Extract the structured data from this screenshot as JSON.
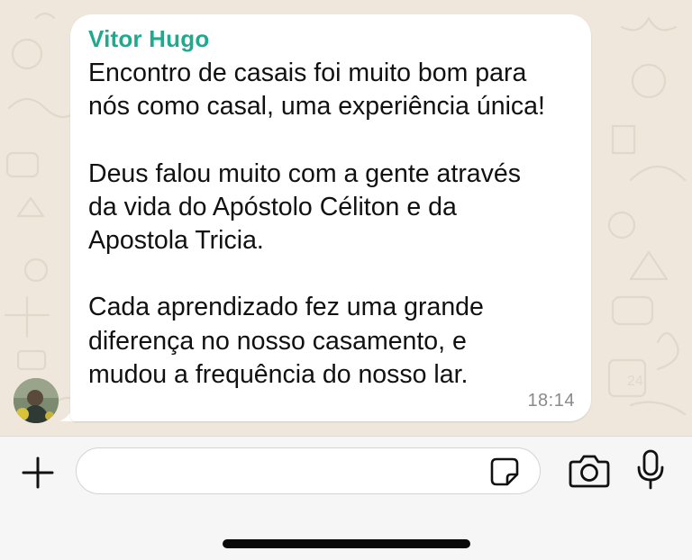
{
  "chat": {
    "wallpaper_color": "#efe7dc",
    "message": {
      "sender": "Vitor Hugo",
      "sender_color": "#1faa8f",
      "text": "Encontro de casais foi muito bom para\nnós como casal, uma experiência única!\n\nDeus falou muito com a gente através\nda vida do Apóstolo Céliton e da\nApostola Tricia.\n\nCada aprendizado fez uma grande\ndiferença no nosso casamento, e\nmudou a frequência do nosso lar.",
      "time": "18:14"
    }
  },
  "input_bar": {
    "attach_icon": "plus-icon",
    "field_value": "",
    "sticker_icon": "sticker-icon",
    "camera_icon": "camera-icon",
    "mic_icon": "microphone-icon"
  }
}
